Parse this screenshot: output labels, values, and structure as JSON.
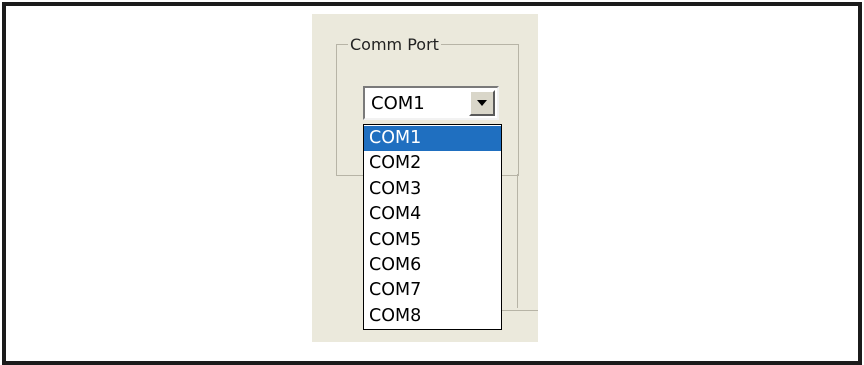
{
  "group": {
    "label": "Comm Port"
  },
  "combo": {
    "value": "COM1",
    "arrow_icon": "dropdown-arrow-icon"
  },
  "dropdown": {
    "options": [
      "COM1",
      "COM2",
      "COM3",
      "COM4",
      "COM5",
      "COM6",
      "COM7",
      "COM8"
    ],
    "highlighted": "COM1"
  },
  "colors": {
    "panel_bg": "#ebe9dc",
    "highlight": "#1f6fc0",
    "frame": "#1b1b1b"
  }
}
